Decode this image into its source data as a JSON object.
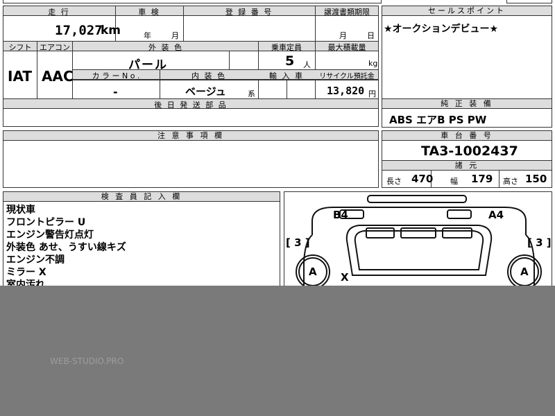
{
  "top": {
    "mileage_label": "走 行",
    "mileage_value": "17,027",
    "mileage_unit": "km",
    "inspection_label": "車 検",
    "inspection_year_unit": "年",
    "inspection_month_unit": "月",
    "registration_label": "登 録 番 号",
    "transfer_label": "譲渡書類期限",
    "transfer_month_unit": "月",
    "transfer_day_unit": "日"
  },
  "spec": {
    "shift_label": "シフト",
    "shift_value": "IAT",
    "ac_label": "エアコン",
    "ac_value": "AAC",
    "exterior_label": "外 装 色",
    "exterior_value": "パール",
    "capacity_label": "乗車定員",
    "capacity_value": "5",
    "capacity_unit": "人",
    "max_load_label": "最大積載量",
    "max_load_unit": "kg",
    "color_no_label": "カ ラ ー N o .",
    "color_no_value": "-",
    "interior_label": "内 装 色",
    "interior_value": "ベージュ",
    "interior_unit": "系",
    "import_label": "輸 入 車",
    "recycle_label": "リサイクル預託金",
    "recycle_value": "13,820",
    "recycle_unit": "円",
    "later_parts_label": "後 日 発 送 部 品"
  },
  "sales": {
    "header": "セールスポイント",
    "text": "★オークションデビュー★"
  },
  "equipment": {
    "header": "純 正 装 備",
    "items": "ABS エアB PS PW"
  },
  "notes": {
    "header": "注 意 事 項 欄"
  },
  "chassis": {
    "header": "車 台 番 号",
    "value": "TA3-1002437",
    "dims_header": "諸 元",
    "length_label": "長さ",
    "length_value": "470",
    "width_label": "幅",
    "width_value": "179",
    "height_label": "高さ",
    "height_value": "150"
  },
  "inspector": {
    "header": "検 査 員 記 入 欄",
    "lines": [
      "現状車",
      "フロントピラー U",
      "エンジン警告灯点灯",
      "外装色 あせ、うすい線キズ",
      "エンジン不調",
      "ミラー X",
      "室内汚れ"
    ]
  },
  "diagram": {
    "b4": "B4",
    "a4": "A4",
    "left_mark": "[ 3 ]",
    "right_mark": "[ 3 ]",
    "left_wheel": "A",
    "right_wheel": "A",
    "x_mark": "X"
  },
  "watermark": "WEB-STUDIO.PRO",
  "colors": {
    "header_bg": "#dddddd",
    "overlay": "#7a7a7a"
  }
}
